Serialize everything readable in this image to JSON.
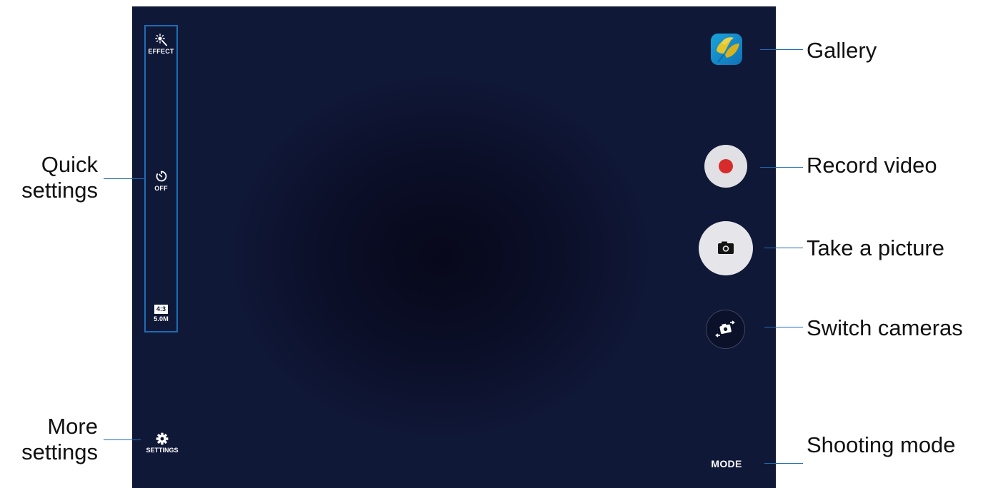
{
  "viewfinder": {
    "quick_settings": {
      "effect": {
        "label": "EFFECT",
        "icon": "effect-icon"
      },
      "timer": {
        "label": "OFF",
        "icon": "timer-icon"
      },
      "ratio": {
        "badge": "4:3",
        "label": "5.0M"
      }
    },
    "settings": {
      "label": "SETTINGS",
      "icon": "gear-icon"
    },
    "gallery": {
      "icon": "gallery-thumbnail"
    },
    "record": {
      "icon": "record-icon",
      "dot_color": "#d82c2c"
    },
    "capture": {
      "icon": "camera-icon"
    },
    "switch": {
      "icon": "switch-camera-icon"
    },
    "mode": {
      "label": "MODE"
    }
  },
  "callouts": {
    "quick_settings": {
      "line1": "Quick",
      "line2": "settings"
    },
    "more_settings": {
      "line1": "More",
      "line2": "settings"
    },
    "gallery": "Gallery",
    "record_video": "Record video",
    "take_picture": "Take a picture",
    "switch_cameras": "Switch cameras",
    "shooting_mode": "Shooting mode"
  },
  "colors": {
    "callout_line": "#1e6cb5",
    "screen_bg": "#0b0f28"
  }
}
